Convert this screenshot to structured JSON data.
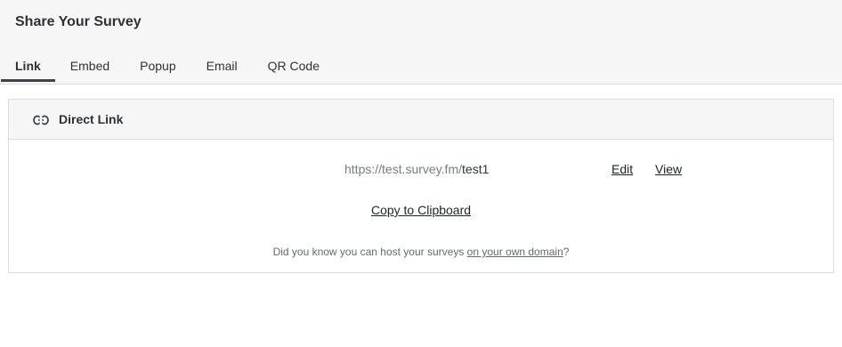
{
  "header": {
    "title": "Share Your Survey",
    "tabs": [
      {
        "label": "Link",
        "active": true
      },
      {
        "label": "Embed",
        "active": false
      },
      {
        "label": "Popup",
        "active": false
      },
      {
        "label": "Email",
        "active": false
      },
      {
        "label": "QR Code",
        "active": false
      }
    ]
  },
  "panel": {
    "icon": "link-icon",
    "title": "Direct Link",
    "url_base": "https://test.survey.fm/",
    "url_slug": "test1",
    "edit_label": "Edit",
    "view_label": "View",
    "copy_label": "Copy to Clipboard",
    "note_prefix": "Did you know you can host your surveys ",
    "note_link": "on your own domain",
    "note_suffix": "?"
  }
}
